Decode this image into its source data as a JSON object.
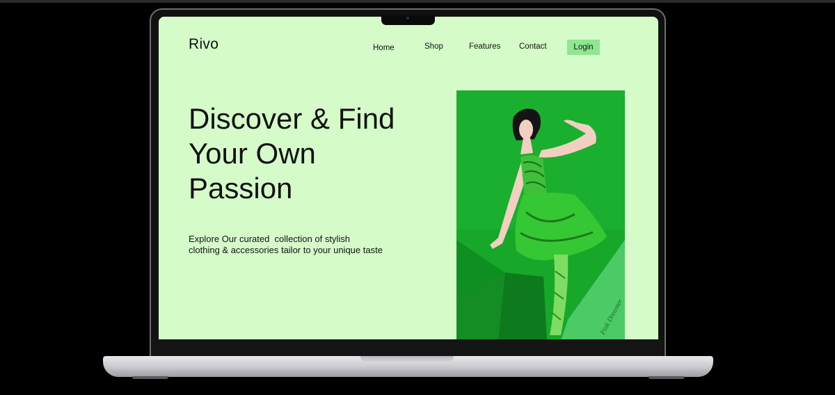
{
  "site": {
    "logo": "Rivo",
    "nav": {
      "home": "Home",
      "shop": "Shop",
      "features": "Features",
      "contact": "Contact",
      "login": "Login"
    },
    "hero": {
      "headline_line1": "Discover & Find",
      "headline_line2": "Your Own",
      "headline_line3": "Passion",
      "subtitle_line1": "Explore Our curated  collection of stylish",
      "subtitle_line2": "clothing & accessories tailor to your unique taste",
      "image": "fashion-model-green-dress",
      "image_caption": "Pink Dreamer"
    }
  },
  "colors": {
    "page_background": "#d5fcc8",
    "login_button": "#8de890",
    "photo_green": "#17a82a"
  }
}
